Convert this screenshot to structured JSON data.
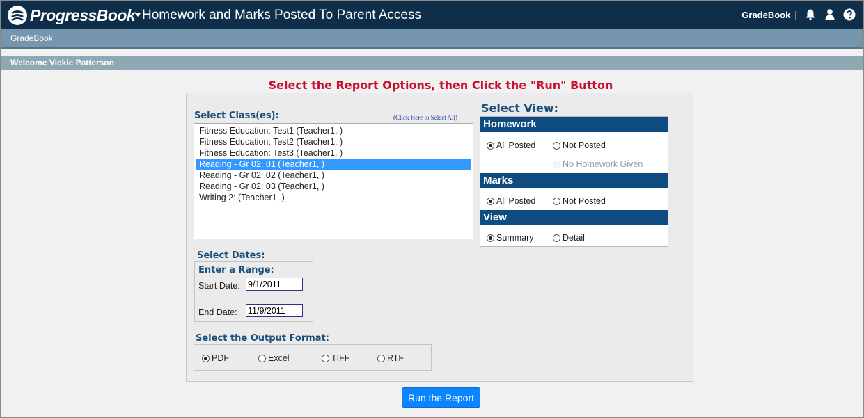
{
  "header": {
    "logo_text": "ProgressBook",
    "logo_reg": ".",
    "page_title": "Homework and Marks Posted To Parent Access",
    "gradebook_link": "GradeBook",
    "pipe": "|",
    "icons": [
      "bell-icon",
      "user-icon",
      "help-icon"
    ]
  },
  "navbar": {
    "item": "GradeBook"
  },
  "welcome": {
    "text": "Welcome Vickie Patterson"
  },
  "instruction": "Select the Report Options, then Click the \"Run\" Button",
  "classes": {
    "label": "Select Class(es):",
    "select_all": "(Click Here to Select All)",
    "items": [
      {
        "label": "Fitness Education: Test1 (Teacher1, )",
        "selected": false
      },
      {
        "label": "Fitness Education: Test2 (Teacher1, )",
        "selected": false
      },
      {
        "label": "Fitness Education: Test3 (Teacher1, )",
        "selected": false
      },
      {
        "label": "Reading - Gr 02: 01 (Teacher1, )",
        "selected": true
      },
      {
        "label": "Reading - Gr 02: 02 (Teacher1, )",
        "selected": false
      },
      {
        "label": "Reading - Gr 02: 03 (Teacher1, )",
        "selected": false
      },
      {
        "label": "Writing 2: (Teacher1, )",
        "selected": false
      }
    ]
  },
  "dates": {
    "label": "Select Dates:",
    "range_label": "Enter a Range:",
    "start_label": "Start Date:",
    "start_value": "9/1/2011",
    "end_label": "End Date:",
    "end_value": "11/9/2011"
  },
  "output": {
    "label": "Select the Output Format:",
    "options": [
      "PDF",
      "Excel",
      "TIFF",
      "RTF"
    ],
    "selected": "PDF"
  },
  "view": {
    "title": "Select View:",
    "homework": {
      "heading": "Homework",
      "all_posted": "All Posted",
      "not_posted": "Not Posted",
      "selected": "All Posted",
      "no_homework": "No Homework Given"
    },
    "marks": {
      "heading": "Marks",
      "all_posted": "All Posted",
      "not_posted": "Not Posted",
      "selected": "All Posted"
    },
    "view_type": {
      "heading": "View",
      "summary": "Summary",
      "detail": "Detail",
      "selected": "Summary"
    }
  },
  "run_button": "Run the Report",
  "colors": {
    "header_bg": "#0f2e4a",
    "navbar_bg": "#7596ad",
    "welcome_bg": "#8ea8b4",
    "instruction": "#c8102e",
    "section_head": "#0f4c81",
    "selected_row": "#3399ff",
    "button": "#0a84ff"
  }
}
